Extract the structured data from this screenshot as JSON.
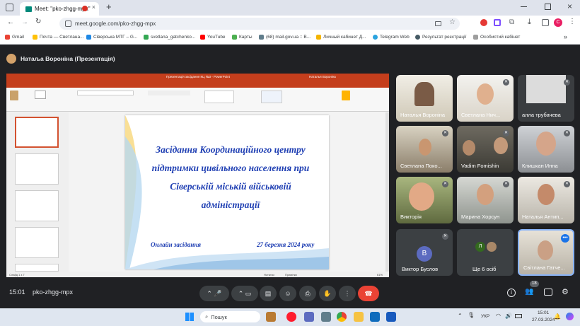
{
  "browser": {
    "tab_title": "Meet: \"pko-zhgg-mpx\"",
    "url": "meet.google.com/pko-zhgg-mpx",
    "bookmarks": [
      "Gmail",
      "Почта — Светлана...",
      "Сіверська МТГ – G...",
      "svetlana_gatchenko...",
      "YouTube",
      "Карты",
      "(68) mail.gov.ua :: В...",
      "Личный кабинет Д...",
      "Telegram Web",
      "Результат реєстрації",
      "Особистий кабінет"
    ],
    "profile_letter": "C"
  },
  "meet": {
    "presenter": "Натаља Воронiна (Презентація)",
    "time": "15:01",
    "meeting_code": "pko-zhgg-mpx",
    "participants_count": "18",
    "participants": [
      {
        "name": "Наталья Воронiна"
      },
      {
        "name": "Светлана Нич..."
      },
      {
        "name": "алла трубачева"
      },
      {
        "name": "Светлана Поко..."
      },
      {
        "name": "Vadim Fomishin"
      },
      {
        "name": "Клишкан Инна"
      },
      {
        "name": "Викторія"
      },
      {
        "name": "Марина Хорсун"
      },
      {
        "name": "Наталья Антип..."
      },
      {
        "name": "Виктор Буслов",
        "initial": "В"
      },
      {
        "name": "Ще 6 осіб",
        "initial": "Л"
      },
      {
        "name": "Світлана Гатче..."
      }
    ]
  },
  "slide": {
    "title": "Засідання Координаційного центру підтримки цивільного населення при Сіверській міській військовій адміністрації",
    "bottom_left": "Онлайн засідання",
    "bottom_right": "27 березня 2024 року",
    "ribbon_title": "Презентація засідання КЦ №3 - PowerPoint",
    "ribbon_user": "Наталья Воронiна",
    "slide_count": "Слайд 1 з 7",
    "notes": "Нотатки",
    "comments": "Примітки",
    "zoom": "61%"
  },
  "taskbar": {
    "search_placeholder": "Пошук",
    "lang": "УКР",
    "clock_time": "15:01",
    "clock_date": "27.03.2024"
  }
}
